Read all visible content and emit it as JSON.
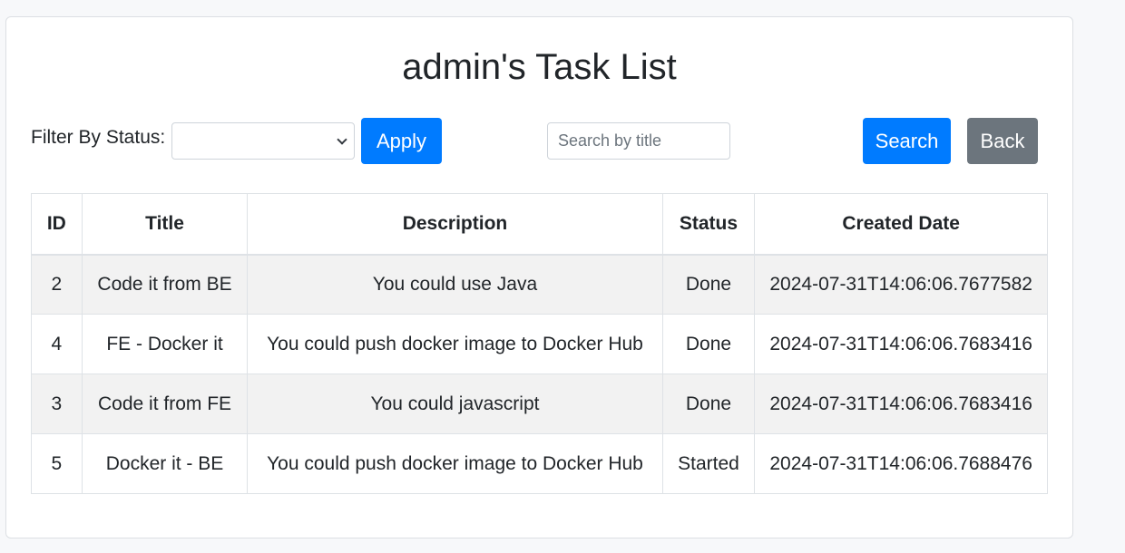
{
  "header": {
    "title": "admin's Task List"
  },
  "filter": {
    "label": "Filter By Status:",
    "selected_value": "",
    "apply_label": "Apply"
  },
  "search": {
    "placeholder": "Search by title",
    "value": "",
    "search_label": "Search",
    "back_label": "Back"
  },
  "colors": {
    "primary": "#007bff",
    "secondary": "#6c757d",
    "stripe": "#f2f2f2"
  },
  "table": {
    "columns": [
      "ID",
      "Title",
      "Description",
      "Status",
      "Created Date"
    ],
    "rows": [
      {
        "id": "2",
        "title": "Code it from BE",
        "description": "You could use Java",
        "status": "Done",
        "created": "2024-07-31T14:06:06.7677582"
      },
      {
        "id": "4",
        "title": "FE - Docker it",
        "description": "You could push docker image to Docker Hub",
        "status": "Done",
        "created": "2024-07-31T14:06:06.7683416"
      },
      {
        "id": "3",
        "title": "Code it from FE",
        "description": "You could javascript",
        "status": "Done",
        "created": "2024-07-31T14:06:06.7683416"
      },
      {
        "id": "5",
        "title": "Docker it - BE",
        "description": "You could push docker image to Docker Hub",
        "status": "Started",
        "created": "2024-07-31T14:06:06.7688476"
      }
    ]
  }
}
